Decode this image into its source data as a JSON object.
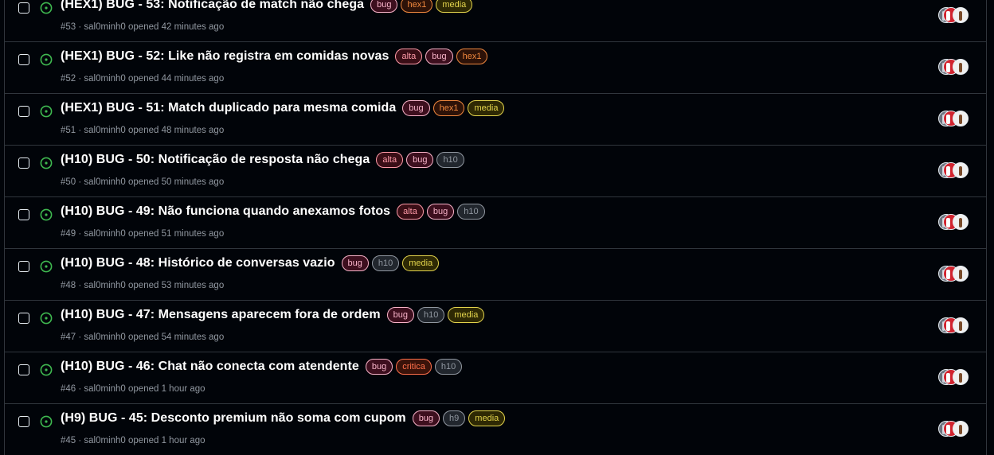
{
  "colors": {
    "open_icon": "#3fb950",
    "label_bug": "#f8b3c9",
    "label_hex1": "#f0883e",
    "label_media": "#e3d44c",
    "label_alta": "#ff9aa8",
    "label_h": "#9198a1",
    "label_critica": "#ff6f4a"
  },
  "issues": [
    {
      "title": "(HEX1) BUG - 53: Notificação de match não chega",
      "meta": "#53 · sal0minh0 opened 42 minutes ago",
      "labels": [
        {
          "text": "bug",
          "kind": "bug"
        },
        {
          "text": "hex1",
          "kind": "hex1"
        },
        {
          "text": "media",
          "kind": "media"
        }
      ]
    },
    {
      "title": "(HEX1) BUG - 52: Like não registra em comidas novas",
      "meta": "#52 · sal0minh0 opened 44 minutes ago",
      "labels": [
        {
          "text": "alta",
          "kind": "alta"
        },
        {
          "text": "bug",
          "kind": "bug"
        },
        {
          "text": "hex1",
          "kind": "hex1"
        }
      ]
    },
    {
      "title": "(HEX1) BUG - 51: Match duplicado para mesma comida",
      "meta": "#51 · sal0minh0 opened 48 minutes ago",
      "labels": [
        {
          "text": "bug",
          "kind": "bug"
        },
        {
          "text": "hex1",
          "kind": "hex1"
        },
        {
          "text": "media",
          "kind": "media"
        }
      ]
    },
    {
      "title": "(H10) BUG - 50: Notificação de resposta não chega",
      "meta": "#50 · sal0minh0 opened 50 minutes ago",
      "labels": [
        {
          "text": "alta",
          "kind": "alta"
        },
        {
          "text": "bug",
          "kind": "bug"
        },
        {
          "text": "h10",
          "kind": "h"
        }
      ]
    },
    {
      "title": "(H10) BUG - 49: Não funciona quando anexamos fotos",
      "meta": "#49 · sal0minh0 opened 51 minutes ago",
      "labels": [
        {
          "text": "alta",
          "kind": "alta"
        },
        {
          "text": "bug",
          "kind": "bug"
        },
        {
          "text": "h10",
          "kind": "h"
        }
      ]
    },
    {
      "title": "(H10) BUG - 48: Histórico de conversas vazio",
      "meta": "#48 · sal0minh0 opened 53 minutes ago",
      "labels": [
        {
          "text": "bug",
          "kind": "bug"
        },
        {
          "text": "h10",
          "kind": "h"
        },
        {
          "text": "media",
          "kind": "media"
        }
      ]
    },
    {
      "title": "(H10) BUG - 47: Mensagens aparecem fora de ordem",
      "meta": "#47 · sal0minh0 opened 54 minutes ago",
      "labels": [
        {
          "text": "bug",
          "kind": "bug"
        },
        {
          "text": "h10",
          "kind": "h"
        },
        {
          "text": "media",
          "kind": "media"
        }
      ]
    },
    {
      "title": "(H10) BUG - 46: Chat não conecta com atendente",
      "meta": "#46 · sal0minh0 opened 1 hour ago",
      "labels": [
        {
          "text": "bug",
          "kind": "bug"
        },
        {
          "text": "critica",
          "kind": "critica"
        },
        {
          "text": "h10",
          "kind": "h"
        }
      ]
    },
    {
      "title": "(H9) BUG - 45: Desconto premium não soma com cupom",
      "meta": "#45 · sal0minh0 opened 1 hour ago",
      "labels": [
        {
          "text": "bug",
          "kind": "bug"
        },
        {
          "text": "h9",
          "kind": "h"
        },
        {
          "text": "media",
          "kind": "media"
        }
      ]
    }
  ]
}
